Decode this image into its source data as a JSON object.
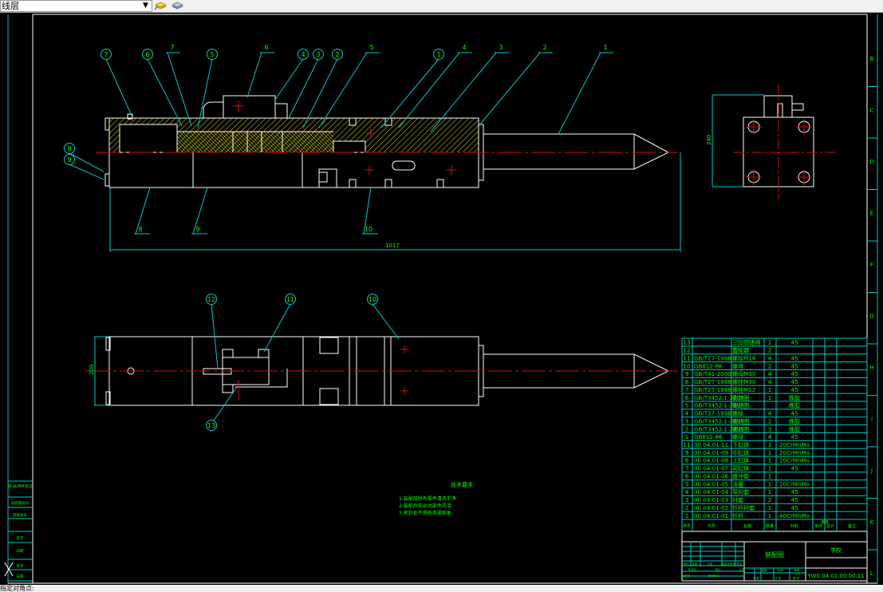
{
  "toolbar": {
    "layer_value": "线层",
    "layer_icon": "layer-state-icon",
    "layer_manager_icon": "layer-manager-icon"
  },
  "status": {
    "command_text": "指定对角点:"
  },
  "colors": {
    "background": "#000000",
    "outline": "#ffffff",
    "dimension": "#00c8c8",
    "text": "#00ff00",
    "centerline": "#d01010",
    "hatch": "#ffff00"
  },
  "drawing": {
    "front_view": {
      "balloons_top": [
        "7",
        "6",
        "5",
        "4",
        "3",
        "2",
        "1"
      ],
      "labels_top": [
        "7",
        "6",
        "5",
        "4",
        "3",
        "2",
        "1"
      ],
      "balloons_left": [
        "8",
        "9"
      ],
      "labels_bottom": [
        "8",
        "9",
        "10"
      ],
      "overall_length": "1017"
    },
    "side_view": {
      "height_dim": "240"
    },
    "top_view": {
      "balloons": [
        "12",
        "11",
        "10",
        "13"
      ],
      "width_dim": "200"
    },
    "tech_req": {
      "title": "技术要求",
      "items": [
        "1.装配前所有零件清洗干净",
        "2.装配后各运动部件灵活",
        "3.密封处不得有渗漏现象"
      ]
    },
    "frame_zones": [
      "B",
      "C",
      "D",
      "E",
      "F",
      "G",
      "H",
      "I",
      "J",
      "K",
      "L"
    ],
    "left_column": [
      "借(通)用件登记",
      "旧底图总号",
      "底图总号",
      "签字",
      "日期",
      "签字",
      "日期"
    ]
  },
  "bom": {
    "header": [
      "序号",
      "代号",
      "名称",
      "数量",
      "材料",
      "单件",
      "总计",
      "备注"
    ],
    "weight_header": "重量",
    "rows": [
      {
        "no": "13",
        "code": "",
        "name": "三位四通阀",
        "qty": "1",
        "mat": "45"
      },
      {
        "no": "12",
        "code": "",
        "name": "蓄能器",
        "qty": "2",
        "mat": ""
      },
      {
        "no": "11",
        "code": "GB/T27-1988",
        "name": "螺栓M16",
        "qty": "4",
        "mat": "45"
      },
      {
        "no": "10",
        "code": "GB812-86",
        "name": "螺母",
        "qty": "2",
        "mat": "45"
      },
      {
        "no": "9",
        "code": "GB/T41-2000",
        "name": "螺母M30",
        "qty": "4",
        "mat": "45"
      },
      {
        "no": "8",
        "code": "GB/T27-1988",
        "name": "螺栓M30",
        "qty": "4",
        "mat": "45"
      },
      {
        "no": "7",
        "code": "GB/T27-1988",
        "name": "螺栓M12",
        "qty": "1",
        "mat": "45"
      },
      {
        "no": "6",
        "code": "GB/T3452.1-2005",
        "name": "密封圈",
        "qty": "1",
        "mat": "橡胶"
      },
      {
        "no": "5",
        "code": "GB/T3452.1-2005",
        "name": "密封圈",
        "qty": "",
        "mat": "橡胶"
      },
      {
        "no": "4",
        "code": "GB/T27-1998",
        "name": "螺栓",
        "qty": "4",
        "mat": "45"
      },
      {
        "no": "3",
        "code": "GB/T3452.1-2005",
        "name": "密封圈",
        "qty": "2",
        "mat": "橡胶"
      },
      {
        "no": "2",
        "code": "GB/T3452.1-2005",
        "name": "密封圈",
        "qty": "3",
        "mat": "橡胶"
      },
      {
        "no": "1",
        "code": "GB812-86",
        "name": "螺母",
        "qty": "4",
        "mat": "45"
      },
      {
        "no": "11",
        "code": "00.04.01-11",
        "name": "下缸体",
        "qty": "1",
        "mat": "20CrMnMo"
      },
      {
        "no": "9",
        "code": "00.04.01-09",
        "name": "中缸体",
        "qty": "1",
        "mat": "20CrMnMo"
      },
      {
        "no": "8",
        "code": "00.04.01-08",
        "name": "上缸体",
        "qty": "1",
        "mat": "20CrMnMo"
      },
      {
        "no": "7",
        "code": "00.04.01-07",
        "name": "前缸体",
        "qty": "1",
        "mat": "45"
      },
      {
        "no": "6",
        "code": "00.04.01-06",
        "name": "缓冲垫",
        "qty": "1",
        "mat": ""
      },
      {
        "no": "5",
        "code": "00.04.01-05",
        "name": "活塞",
        "qty": "1",
        "mat": "20CrMnMo"
      },
      {
        "no": "4",
        "code": "00.04.01-04",
        "name": "导向套",
        "qty": "1",
        "mat": "45"
      },
      {
        "no": "3",
        "code": "00.04.01-03",
        "name": "衬套",
        "qty": "2",
        "mat": "45"
      },
      {
        "no": "2",
        "code": "00.04.01-02",
        "name": "钎杆衬套",
        "qty": "1",
        "mat": "45"
      },
      {
        "no": "1",
        "code": "00.04.01-01",
        "name": "钎杆",
        "qty": "1",
        "mat": "40CrMnMo"
      }
    ]
  },
  "title_block": {
    "drawing_title": "装配图",
    "company": "学校",
    "drawing_no": "YW0.04.01.00.00.11",
    "cells": [
      "标记",
      "处数",
      "分区",
      "更改文件号",
      "签名",
      "年月日",
      "设计",
      "标准化",
      "阶段标记",
      "重量",
      "比例",
      "审核",
      "工艺",
      "批准",
      "共 张",
      "第 张",
      "1:5"
    ]
  }
}
